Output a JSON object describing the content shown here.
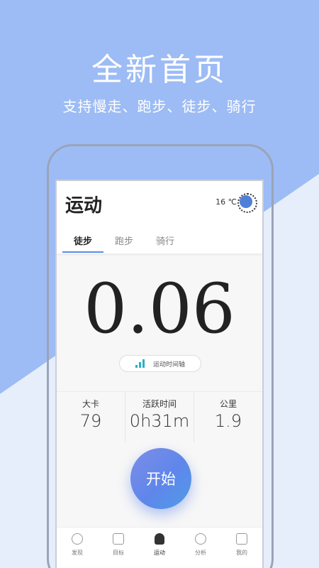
{
  "hero": {
    "title": "全新首页",
    "subtitle": "支持慢走、跑步、徒步、骑行"
  },
  "app": {
    "title": "运动",
    "weather": {
      "temperature": "16 ℃",
      "icon": "weather-icon"
    },
    "tabs": [
      {
        "label": "徒步",
        "active": true
      },
      {
        "label": "跑步",
        "active": false
      },
      {
        "label": "骑行",
        "active": false
      }
    ],
    "distance_value": "0.06",
    "timeline_button": "运动时间轴",
    "stats": [
      {
        "label": "大卡",
        "value": "79"
      },
      {
        "label": "活跃时间",
        "value": "0h31m"
      },
      {
        "label": "公里",
        "value": "1.9"
      }
    ],
    "start_button": "开始",
    "bottom_nav": [
      {
        "label": "发现",
        "icon": "bulb-icon"
      },
      {
        "label": "目标",
        "icon": "flag-icon"
      },
      {
        "label": "运动",
        "icon": "shoe-icon",
        "active": true
      },
      {
        "label": "分析",
        "icon": "chart-icon"
      },
      {
        "label": "我的",
        "icon": "profile-icon"
      }
    ]
  },
  "colors": {
    "background_top": "#9dbcf5",
    "background_bottom": "#e6eefb",
    "accent": "#5a8fdc",
    "start_gradient": [
      "#7d8ee8",
      "#4f9ce8"
    ]
  }
}
